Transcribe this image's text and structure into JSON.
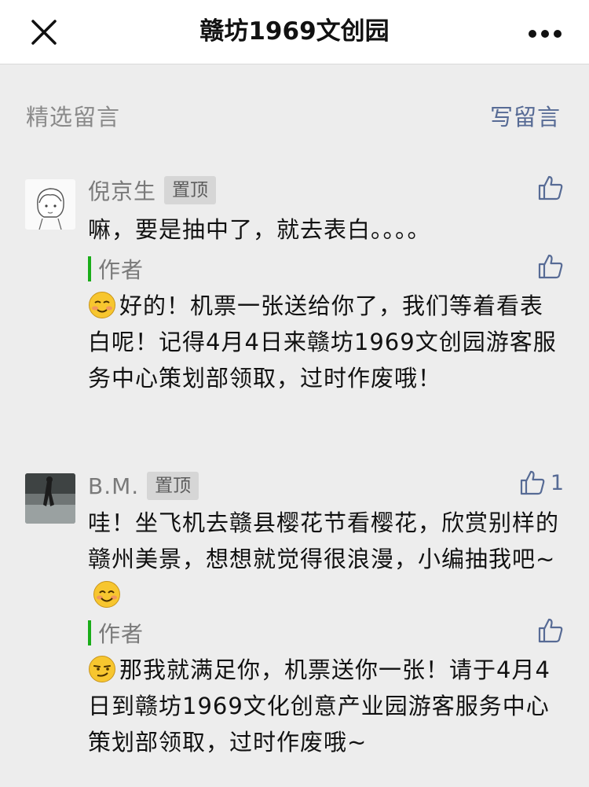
{
  "nav": {
    "title": "赣坊1969文创园"
  },
  "section": {
    "title": "精选留言",
    "write_label": "写留言"
  },
  "comments": [
    {
      "nickname": "倪京生",
      "badge": "置顶",
      "text": "嘛，要是抽中了，就去表白。。。。",
      "reply": {
        "label": "作者",
        "text": "好的！机票一张送给你了，我们等着看表白呢！记得4月4日来赣坊1969文创园游客服务中心策划部领取，过时作废哦！"
      }
    },
    {
      "nickname": "B.M.",
      "badge": "置顶",
      "like_count": "1",
      "text": "哇！坐飞机去赣县樱花节看樱花，欣赏别样的赣州美景，想想就觉得很浪漫，小编抽我吧~",
      "reply": {
        "label": "作者",
        "text": "那我就满足你，机票送你一张！请于4月4日到赣坊1969文化创意产业园游客服务中心策划部领取，过时作废哦~"
      }
    }
  ]
}
